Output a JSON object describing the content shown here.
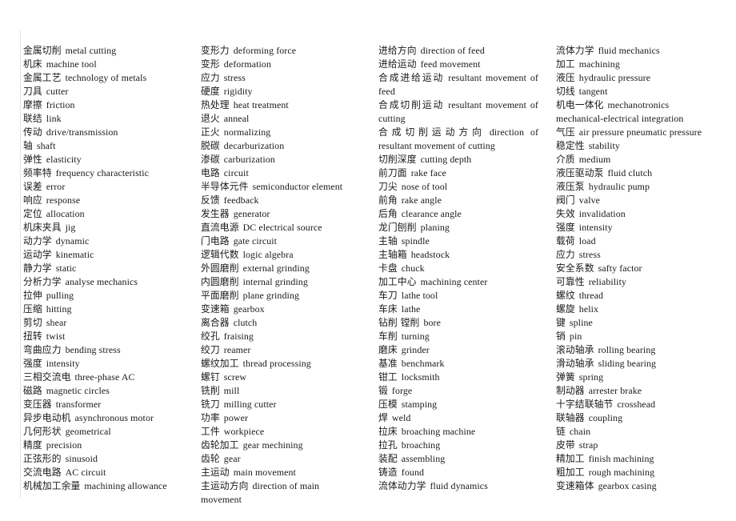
{
  "document": {
    "type": "glossary",
    "title": "",
    "language_pair": "Chinese-English",
    "subject": "mechanical engineering / metal cutting terminology",
    "column_count": 4
  },
  "columns": [
    {
      "id": "column-1",
      "justified": false,
      "entries": [
        {
          "zh": "金属切削",
          "en": "metal cutting"
        },
        {
          "zh": "机床",
          "en": "machine tool"
        },
        {
          "zh": "金属工艺",
          "en": "technology of metals"
        },
        {
          "zh": "刀具",
          "en": "cutter"
        },
        {
          "zh": "摩擦",
          "en": "friction"
        },
        {
          "zh": "联结",
          "en": "link"
        },
        {
          "zh": "传动",
          "en": "drive/transmission"
        },
        {
          "zh": "轴",
          "en": "shaft"
        },
        {
          "zh": "弹性",
          "en": "elasticity"
        },
        {
          "zh": "频率特",
          "en": "frequency characteristic"
        },
        {
          "zh": "误差",
          "en": "error"
        },
        {
          "zh": "响应",
          "en": "response"
        },
        {
          "zh": "定位",
          "en": "allocation"
        },
        {
          "zh": "机床夹具",
          "en": "jig"
        },
        {
          "zh": "动力学",
          "en": "dynamic"
        },
        {
          "zh": "运动学",
          "en": "kinematic"
        },
        {
          "zh": "静力学",
          "en": "static"
        },
        {
          "zh": "分析力学",
          "en": "analyse mechanics"
        },
        {
          "zh": "拉伸",
          "en": "pulling"
        },
        {
          "zh": "压缩",
          "en": "hitting"
        },
        {
          "zh": "剪切",
          "en": "shear"
        },
        {
          "zh": "扭转",
          "en": "twist"
        },
        {
          "zh": "弯曲应力",
          "en": "bending stress"
        },
        {
          "zh": "强度",
          "en": "intensity"
        },
        {
          "zh": "三相交流电",
          "en": "three-phase AC"
        },
        {
          "zh": "磁路",
          "en": "magnetic circles"
        },
        {
          "zh": "变压器",
          "en": "transformer"
        },
        {
          "zh": "异步电动机",
          "en": "asynchronous motor"
        },
        {
          "zh": "几何形状",
          "en": "geometrical"
        },
        {
          "zh": "精度",
          "en": "precision"
        },
        {
          "zh": "正弦形的",
          "en": "sinusoid"
        },
        {
          "zh": "交流电路",
          "en": "AC circuit"
        },
        {
          "zh": "机械加工余量",
          "en": "machining allowance"
        }
      ]
    },
    {
      "id": "column-2",
      "justified": false,
      "entries": [
        {
          "zh": "变形力",
          "en": "deforming force"
        },
        {
          "zh": "变形",
          "en": "deformation"
        },
        {
          "zh": "应力",
          "en": "stress"
        },
        {
          "zh": "硬度",
          "en": "rigidity"
        },
        {
          "zh": "热处理",
          "en": "heat treatment"
        },
        {
          "zh": "退火",
          "en": "anneal"
        },
        {
          "zh": "正火",
          "en": "normalizing"
        },
        {
          "zh": "脱碳",
          "en": "decarburization"
        },
        {
          "zh": "渗碳",
          "en": "carburization"
        },
        {
          "zh": "电路",
          "en": "circuit"
        },
        {
          "zh": "半导体元件",
          "en": "semiconductor element"
        },
        {
          "zh": "反馈",
          "en": "feedback"
        },
        {
          "zh": "发生器",
          "en": "generator"
        },
        {
          "zh": "直流电源",
          "en": "DC electrical source"
        },
        {
          "zh": "门电路",
          "en": "gate circuit"
        },
        {
          "zh": "逻辑代数",
          "en": "logic algebra"
        },
        {
          "zh": "外圆磨削",
          "en": "external grinding"
        },
        {
          "zh": "内圆磨削",
          "en": "internal grinding"
        },
        {
          "zh": "平面磨削",
          "en": "plane grinding"
        },
        {
          "zh": "变速箱",
          "en": "gearbox"
        },
        {
          "zh": "离合器",
          "en": "clutch"
        },
        {
          "zh": "绞孔",
          "en": "fraising"
        },
        {
          "zh": "绞刀",
          "en": "reamer"
        },
        {
          "zh": "螺纹加工",
          "en": "thread processing"
        },
        {
          "zh": "螺钉",
          "en": "screw"
        },
        {
          "zh": "铣削",
          "en": "mill"
        },
        {
          "zh": "铣刀",
          "en": "milling cutter"
        },
        {
          "zh": "功率",
          "en": "power"
        },
        {
          "zh": "工件",
          "en": "workpiece"
        },
        {
          "zh": "齿轮加工",
          "en": "gear mechining"
        },
        {
          "zh": "齿轮",
          "en": "gear"
        },
        {
          "zh": "主运动",
          "en": "main movement"
        },
        {
          "zh": "主运动方向",
          "en": "direction of main movement"
        }
      ]
    },
    {
      "id": "column-3",
      "justified": true,
      "entries": [
        {
          "zh": "进给方向",
          "en": "direction of feed"
        },
        {
          "zh": "进给运动",
          "en": "feed movement"
        },
        {
          "zh": "合成进给运动",
          "en": "resultant movement of feed"
        },
        {
          "zh": "合成切削运动",
          "en": "resultant movement of cutting"
        },
        {
          "zh": "合成切削运动方向",
          "en": "direction of resultant movement of cutting"
        },
        {
          "zh": "切削深度",
          "en": "cutting depth"
        },
        {
          "zh": "前刀面",
          "en": "rake face"
        },
        {
          "zh": "刀尖",
          "en": "nose of tool"
        },
        {
          "zh": "前角",
          "en": "rake angle"
        },
        {
          "zh": "后角",
          "en": "clearance angle"
        },
        {
          "zh": "龙门刨削",
          "en": "planing"
        },
        {
          "zh": "主轴",
          "en": "spindle"
        },
        {
          "zh": "主轴箱",
          "en": "headstock"
        },
        {
          "zh": "卡盘",
          "en": "chuck"
        },
        {
          "zh": "加工中心",
          "en": "machining center"
        },
        {
          "zh": "车刀",
          "en": "lathe tool"
        },
        {
          "zh": "车床",
          "en": "lathe"
        },
        {
          "zh": "钻削 镗削",
          "en": "bore"
        },
        {
          "zh": "车削",
          "en": "turning"
        },
        {
          "zh": "磨床",
          "en": "grinder"
        },
        {
          "zh": "基准",
          "en": "benchmark"
        },
        {
          "zh": "钳工",
          "en": "locksmith"
        },
        {
          "zh": "锻",
          "en": "forge"
        },
        {
          "zh": "压模",
          "en": "stamping"
        },
        {
          "zh": "焊",
          "en": "weld"
        },
        {
          "zh": "拉床",
          "en": "broaching machine"
        },
        {
          "zh": "拉孔",
          "en": "broaching"
        },
        {
          "zh": "装配",
          "en": "assembling"
        },
        {
          "zh": "铸造",
          "en": "found"
        },
        {
          "zh": "流体动力学",
          "en": "fluid dynamics"
        }
      ]
    },
    {
      "id": "column-4",
      "justified": false,
      "entries": [
        {
          "zh": "流体力学",
          "en": "fluid mechanics"
        },
        {
          "zh": "加工",
          "en": "machining"
        },
        {
          "zh": "液压",
          "en": "hydraulic pressure"
        },
        {
          "zh": "切线",
          "en": "tangent"
        },
        {
          "zh": "机电一体化",
          "en": "mechanotronics mechanical-electrical integration"
        },
        {
          "zh": "气压",
          "en": "air pressure pneumatic pressure"
        },
        {
          "zh": "稳定性",
          "en": "stability"
        },
        {
          "zh": "介质",
          "en": "medium"
        },
        {
          "zh": "液压驱动泵",
          "en": "fluid clutch"
        },
        {
          "zh": "液压泵",
          "en": "hydraulic pump"
        },
        {
          "zh": "阀门",
          "en": "valve"
        },
        {
          "zh": "失效",
          "en": "invalidation"
        },
        {
          "zh": "强度",
          "en": "intensity"
        },
        {
          "zh": "载荷",
          "en": "load"
        },
        {
          "zh": "应力",
          "en": "stress"
        },
        {
          "zh": "安全系数",
          "en": "safty factor"
        },
        {
          "zh": "可靠性",
          "en": "reliability"
        },
        {
          "zh": "螺纹",
          "en": "thread"
        },
        {
          "zh": "螺旋",
          "en": "helix"
        },
        {
          "zh": "键",
          "en": "spline"
        },
        {
          "zh": "销",
          "en": "pin"
        },
        {
          "zh": "滚动轴承",
          "en": "rolling bearing"
        },
        {
          "zh": "滑动轴承",
          "en": "sliding bearing"
        },
        {
          "zh": "弹簧",
          "en": "spring"
        },
        {
          "zh": "制动器",
          "en": "arrester brake"
        },
        {
          "zh": "十字结联轴节",
          "en": "crosshead"
        },
        {
          "zh": "联轴器",
          "en": "coupling"
        },
        {
          "zh": "链",
          "en": "chain"
        },
        {
          "zh": "皮带",
          "en": "strap"
        },
        {
          "zh": "精加工",
          "en": "finish machining"
        },
        {
          "zh": "粗加工",
          "en": "rough machining"
        },
        {
          "zh": "变速箱体",
          "en": "gearbox casing"
        }
      ]
    }
  ]
}
